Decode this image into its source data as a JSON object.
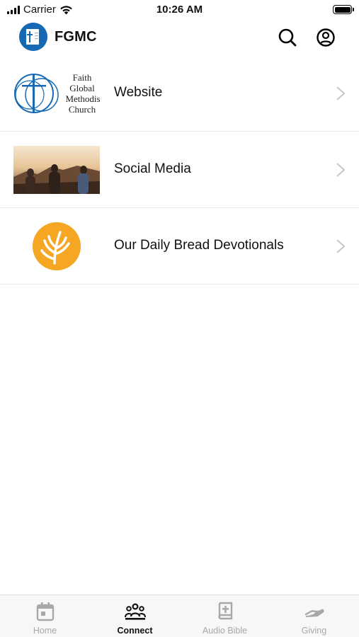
{
  "status_bar": {
    "carrier": "Carrier",
    "time": "10:26 AM"
  },
  "header": {
    "title": "FGMC",
    "search_icon": "search-icon",
    "account_icon": "account-circle-icon"
  },
  "items": [
    {
      "label": "Website",
      "thumbnail": "faith-global-methodist-church-logo",
      "thumbnail_text": [
        "Faith",
        "Global",
        "Methodis",
        "Church"
      ]
    },
    {
      "label": "Social Media",
      "thumbnail": "people-at-sunset-photo"
    },
    {
      "label": "Our Daily Bread Devotionals",
      "thumbnail": "our-daily-bread-wheat-logo"
    }
  ],
  "tabs": [
    {
      "label": "Home",
      "icon": "calendar-icon",
      "active": false
    },
    {
      "label": "Connect",
      "icon": "people-group-icon",
      "active": true
    },
    {
      "label": "Audio Bible",
      "icon": "bible-icon",
      "active": false
    },
    {
      "label": "Giving",
      "icon": "hand-giving-icon",
      "active": false
    }
  ],
  "colors": {
    "brand_blue": "#1769b4",
    "odb_orange": "#f5a623",
    "active_tab": "#111111",
    "inactive_tab": "#a8a8a8"
  }
}
